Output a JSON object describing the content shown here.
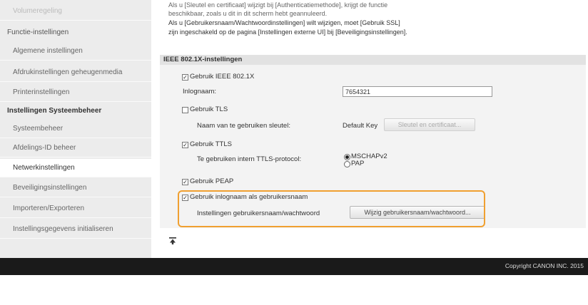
{
  "sidebar": {
    "items": [
      {
        "label": "Volumeregeling"
      },
      {
        "label": "Functie-instellingen"
      },
      {
        "label": "Algemene instellingen"
      },
      {
        "label": "Afdrukinstellingen geheugenmedia"
      },
      {
        "label": "Printerinstellingen"
      },
      {
        "label": "Instellingen Systeembeheer"
      },
      {
        "label": "Systeembeheer"
      },
      {
        "label": "Afdelings-ID beheer"
      },
      {
        "label": "Netwerkinstellingen"
      },
      {
        "label": "Beveiligingsinstellingen"
      },
      {
        "label": "Importeren/Exporteren"
      },
      {
        "label": "Instellingsgegevens initialiseren"
      }
    ]
  },
  "intro": {
    "line0": "Als u [Sleutel en certificaat] wijzigt bij [Authenticatiemethode], krijgt de functie",
    "line1": "beschikbaar, zoals u dit in dit scherm hebt geannuleerd.",
    "line2": "Als u [Gebruikersnaam/Wachtwoordinstellingen] wilt wijzigen, moet [Gebruik SSL]",
    "line3": "zijn ingeschakeld op de pagina [Instellingen externe UI] bij [Beveiligingsinstellingen]."
  },
  "panel": {
    "title": "IEEE 802.1X-instellingen",
    "use_ieee": {
      "label": "Gebruik IEEE 802.1X",
      "checked": true
    },
    "login_name_label": "Inlognaam:",
    "login_name_value": "7654321",
    "use_tls": {
      "label": "Gebruik TLS",
      "checked": false
    },
    "key_name_label": "Naam van te gebruiken sleutel:",
    "default_key": "Default Key",
    "key_cert_button": "Sleutel en certificaat...",
    "use_ttls": {
      "label": "Gebruik TTLS",
      "checked": true
    },
    "ttls_protocol_label": "Te gebruiken intern TTLS-protocol:",
    "ttls_options": [
      "MSCHAPv2",
      "PAP"
    ],
    "ttls_selected": "MSCHAPv2",
    "use_peap": {
      "label": "Gebruik PEAP",
      "checked": true
    },
    "use_login_as_user": {
      "label": "Gebruik inlognaam als gebruikersnaam",
      "checked": true
    },
    "user_pwd_label": "Instellingen gebruikersnaam/wachtwoord",
    "change_button": "Wijzig gebruikersnaam/wachtwoord...",
    "highlight_color": "#f0a030"
  },
  "page_top_icon": "arrow-to-top-icon",
  "footer": {
    "copyright": "Copyright CANON INC. 2015"
  }
}
